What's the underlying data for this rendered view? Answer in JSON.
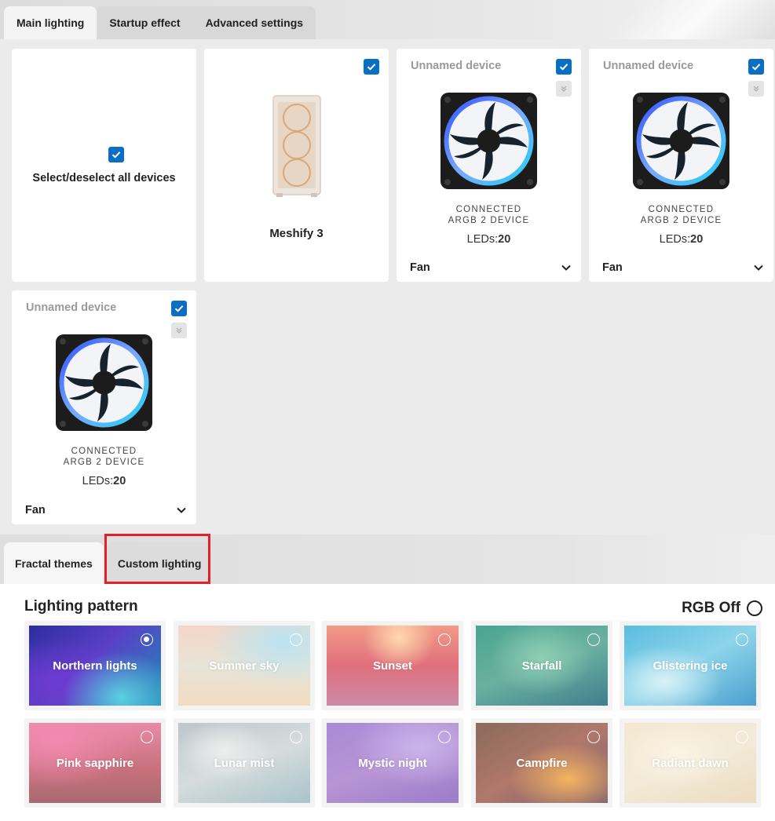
{
  "top_tabs": {
    "main_lighting": "Main lighting",
    "startup_effect": "Startup effect",
    "advanced_settings": "Advanced settings"
  },
  "devices": {
    "select_all_label": "Select/deselect all devices",
    "case_name": "Meshify 3",
    "fans": [
      {
        "name": "Unnamed device",
        "connected_line1": "CONNECTED",
        "connected_line2": "ARGB 2 DEVICE",
        "leds_label": "LEDs:",
        "leds_count": "20",
        "type": "Fan"
      },
      {
        "name": "Unnamed device",
        "connected_line1": "CONNECTED",
        "connected_line2": "ARGB 2 DEVICE",
        "leds_label": "LEDs:",
        "leds_count": "20",
        "type": "Fan"
      },
      {
        "name": "Unnamed device",
        "connected_line1": "CONNECTED",
        "connected_line2": "ARGB 2 DEVICE",
        "leds_label": "LEDs:",
        "leds_count": "20",
        "type": "Fan"
      }
    ]
  },
  "bottom_tabs": {
    "fractal_themes": "Fractal themes",
    "custom_lighting": "Custom lighting"
  },
  "lighting": {
    "title": "Lighting pattern",
    "rgb_off_label": "RGB Off",
    "patterns": [
      {
        "label": "Northern lights",
        "selected": true
      },
      {
        "label": "Summer sky",
        "selected": false
      },
      {
        "label": "Sunset",
        "selected": false
      },
      {
        "label": "Starfall",
        "selected": false
      },
      {
        "label": "Glistering ice",
        "selected": false
      },
      {
        "label": "Pink sapphire",
        "selected": false
      },
      {
        "label": "Lunar mist",
        "selected": false
      },
      {
        "label": "Mystic night",
        "selected": false
      },
      {
        "label": "Campfire",
        "selected": false
      },
      {
        "label": "Radiant dawn",
        "selected": false
      }
    ]
  },
  "colors": {
    "accent_blue": "#0a6ec2",
    "highlight_red": "#e0202a"
  }
}
